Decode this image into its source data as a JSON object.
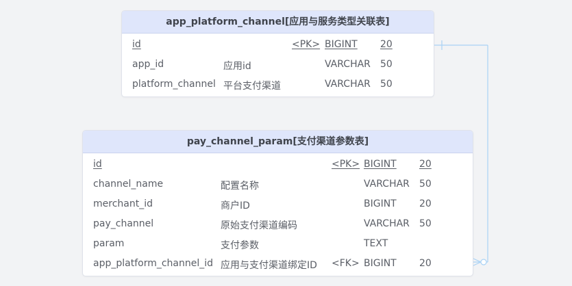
{
  "tables": [
    {
      "title": "app_platform_channel[应用与服务类型关联表]",
      "columns": [
        {
          "name": "id",
          "comment": "",
          "key": "<PK>",
          "type": "BIGINT",
          "length": "20",
          "primary": true
        },
        {
          "name": "app_id",
          "comment": "应用id",
          "key": "",
          "type": "VARCHAR",
          "length": "50",
          "primary": false
        },
        {
          "name": "platform_channel",
          "comment": "平台支付渠道",
          "key": "",
          "type": "VARCHAR",
          "length": "50",
          "primary": false
        }
      ]
    },
    {
      "title": "pay_channel_param[支付渠道参数表]",
      "columns": [
        {
          "name": "id",
          "comment": "",
          "key": "<PK>",
          "type": "BIGINT",
          "length": "20",
          "primary": true
        },
        {
          "name": "channel_name",
          "comment": "配置名称",
          "key": "",
          "type": "VARCHAR",
          "length": "50",
          "primary": false
        },
        {
          "name": "merchant_id",
          "comment": "商户ID",
          "key": "",
          "type": "BIGINT",
          "length": "20",
          "primary": false
        },
        {
          "name": "pay_channel",
          "comment": "原始支付渠道编码",
          "key": "",
          "type": "VARCHAR",
          "length": "50",
          "primary": false
        },
        {
          "name": "param",
          "comment": "支付参数",
          "key": "",
          "type": "TEXT",
          "length": "",
          "primary": false
        },
        {
          "name": "app_platform_channel_id",
          "comment": "应用与支付渠道绑定ID",
          "key": "<FK>",
          "type": "BIGINT",
          "length": "20",
          "primary": false
        }
      ]
    }
  ],
  "relationship": {
    "from_table": "app_platform_channel",
    "to_table": "pay_channel_param",
    "cardinality": "one-to-many",
    "line_color": "#a9d2f5"
  }
}
